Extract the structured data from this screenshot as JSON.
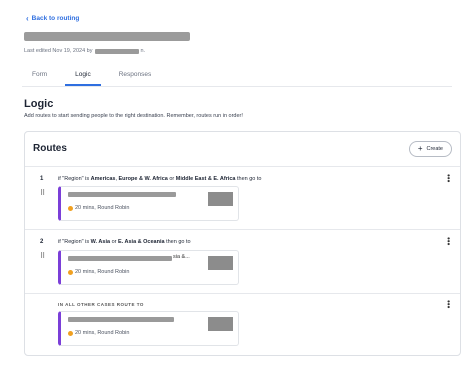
{
  "nav": {
    "back_label": "Back to routing"
  },
  "header": {
    "edited_prefix": "Last edited Nov 19, 2024 by",
    "edited_suffix": "n."
  },
  "tabs": [
    {
      "label": "Form"
    },
    {
      "label": "Logic"
    },
    {
      "label": "Responses"
    }
  ],
  "logic": {
    "title": "Logic",
    "subtitle": "Add routes to start sending people to the right destination. Remember, routes run in order!"
  },
  "routes_panel": {
    "title": "Routes",
    "create_label": "Create",
    "routes": [
      {
        "number": "1",
        "cond_if": "if",
        "field": "\"Region\"",
        "is": "is",
        "v1": "Americas",
        "v2": "Europe & W. Africa",
        "or": "or",
        "v3": "Middle East & E. Africa",
        "then": "then go to",
        "meta": "20 mins, Round Robin"
      },
      {
        "number": "2",
        "cond_if": "if",
        "field": "\"Region\"",
        "is": "is",
        "v1": "W. Asia",
        "or": "or",
        "v2": "E. Asia & Oceania",
        "then": "then go to",
        "name_tail": "sia &...",
        "meta": "20 mins, Round Robin"
      }
    ],
    "fallback": {
      "label": "IN ALL OTHER CASES ROUTE TO",
      "meta": "20 mins, Round Robin"
    }
  }
}
